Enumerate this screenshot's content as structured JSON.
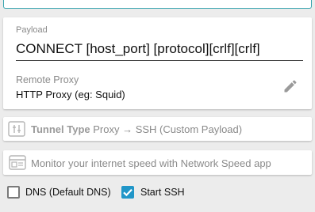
{
  "payload": {
    "label": "Payload",
    "value": "CONNECT [host_port] [protocol][crlf][crlf]"
  },
  "remote_proxy": {
    "label": "Remote Proxy",
    "value": "HTTP Proxy (eg: Squid)",
    "edit_icon": "pencil-icon"
  },
  "tunnel": {
    "key": "Tunnel Type",
    "value": "Proxy → SSH (Custom Payload)",
    "icon": "tunnel-settings-icon"
  },
  "monitor": {
    "text": "Monitor your internet speed with Network Speed app",
    "icon": "app-window-icon"
  },
  "options": {
    "dns_label": "DNS (Default DNS)",
    "dns_checked": false,
    "ssh_label": "Start SSH",
    "ssh_checked": true
  },
  "colors": {
    "accent": "#2196c8",
    "focus_border": "#3aa6b0",
    "secondary_text": "#8a8a8a"
  }
}
